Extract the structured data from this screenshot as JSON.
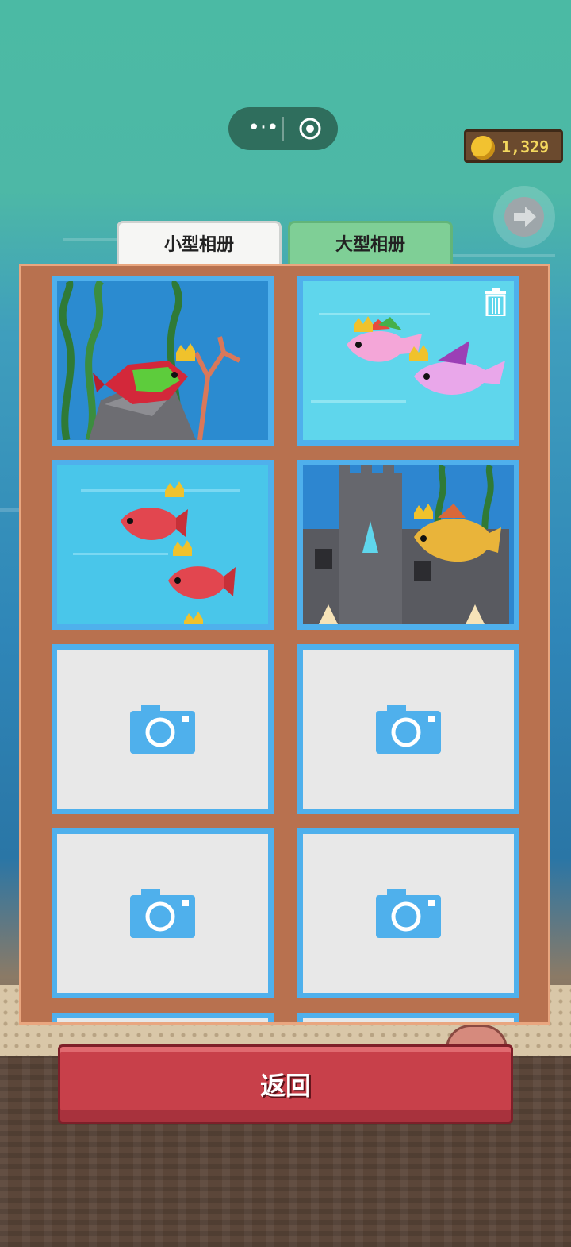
{
  "header": {
    "coins": "1,329"
  },
  "tabs": [
    {
      "label": "小型相册",
      "active": false
    },
    {
      "label": "大型相册",
      "active": true
    }
  ],
  "album": {
    "slots": [
      {
        "state": "photo",
        "scene": "seaweed-rock-fish"
      },
      {
        "state": "photo",
        "scene": "two-fish-open-water",
        "deletable": true
      },
      {
        "state": "photo",
        "scene": "red-fish-pair"
      },
      {
        "state": "photo",
        "scene": "castle-goldfish"
      },
      {
        "state": "empty",
        "icon": "camera-icon"
      },
      {
        "state": "empty",
        "icon": "camera-icon"
      },
      {
        "state": "empty",
        "icon": "camera-icon"
      },
      {
        "state": "empty",
        "icon": "camera-icon"
      }
    ]
  },
  "footer": {
    "back_label": "返回"
  },
  "colors": {
    "frame": "#b8714f",
    "slot_border": "#4fb0ec",
    "active_tab": "#7fcf96",
    "back_button": "#c8404a",
    "coin_text": "#f4d85e"
  }
}
